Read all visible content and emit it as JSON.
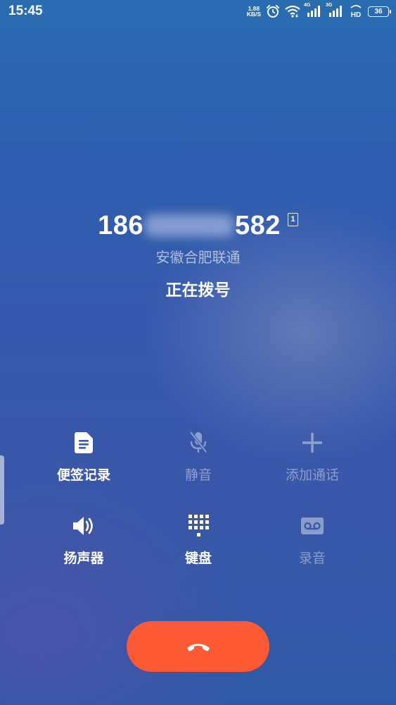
{
  "status_bar": {
    "time": "15:45",
    "net_speed_value": "1.88",
    "net_speed_unit": "KB/S",
    "signal1_label": "4G",
    "signal2_label": "3G",
    "hd_label": "HD",
    "battery_level": "36",
    "icons": [
      "alarm-clock-icon",
      "wifi-icon",
      "signal-4g-icon",
      "signal-3g-icon",
      "hd-voice-icon",
      "battery-icon"
    ]
  },
  "call": {
    "number_prefix": "186",
    "number_suffix": "582",
    "sim_slot": "1",
    "location": "安徽合肥联通",
    "status": "正在拨号"
  },
  "controls": [
    {
      "id": "notes",
      "label": "便签记录",
      "icon": "note-icon",
      "enabled": true
    },
    {
      "id": "mute",
      "label": "静音",
      "icon": "mic-off-icon",
      "enabled": false
    },
    {
      "id": "add_call",
      "label": "添加通话",
      "icon": "plus-icon",
      "enabled": false
    },
    {
      "id": "speaker",
      "label": "扬声器",
      "icon": "speaker-icon",
      "enabled": true
    },
    {
      "id": "keypad",
      "label": "键盘",
      "icon": "dialpad-icon",
      "enabled": true
    },
    {
      "id": "record",
      "label": "录音",
      "icon": "voicemail-record-icon",
      "enabled": false
    }
  ],
  "end_call": {
    "icon": "hang-up-icon",
    "color": "#fc5a34"
  }
}
